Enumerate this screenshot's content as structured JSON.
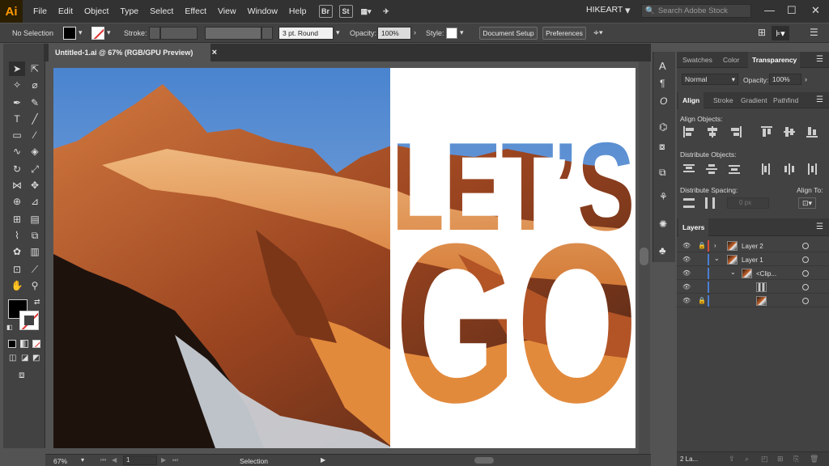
{
  "app": {
    "logo": "Ai",
    "menus": [
      "File",
      "Edit",
      "Object",
      "Type",
      "Select",
      "Effect",
      "View",
      "Window",
      "Help"
    ],
    "bridge_label": "Br",
    "stock_label": "St",
    "workspace": "HIKEART",
    "search_placeholder": "Search Adobe Stock"
  },
  "control": {
    "selection": "No Selection",
    "stroke_label": "Stroke:",
    "brush": "3 pt. Round",
    "opacity_label": "Opacity:",
    "opacity_value": "100%",
    "style_label": "Style:",
    "doc_setup": "Document Setup",
    "preferences": "Preferences"
  },
  "document": {
    "tab_title": "Untitled-1.ai @ 67% (RGB/GPU Preview)",
    "close": "×"
  },
  "artwork": {
    "line1": "LET’S",
    "line2": "GO"
  },
  "status": {
    "zoom": "67%",
    "artboard": "1",
    "tool": "Selection"
  },
  "transparency_panel": {
    "tabs": [
      "Swatches",
      "Color",
      "Transparency"
    ],
    "blend_mode": "Normal",
    "opacity_label": "Opacity:",
    "opacity_value": "100%"
  },
  "align_panel": {
    "tabs": [
      "Align",
      "Stroke",
      "Gradient",
      "Pathfind"
    ],
    "align_objects": "Align Objects:",
    "distribute_objects": "Distribute Objects:",
    "distribute_spacing": "Distribute Spacing:",
    "align_to": "Align To:",
    "spacing_value": "0 px"
  },
  "layers_panel": {
    "title": "Layers",
    "layers": [
      "Layer 2",
      "Layer 1",
      "<Clip..."
    ],
    "footer_count": "2 La..."
  },
  "colors": {
    "accent_red": "#d94b3a",
    "accent_blue": "#4a7fd4",
    "sky": "#5b8fd0"
  }
}
